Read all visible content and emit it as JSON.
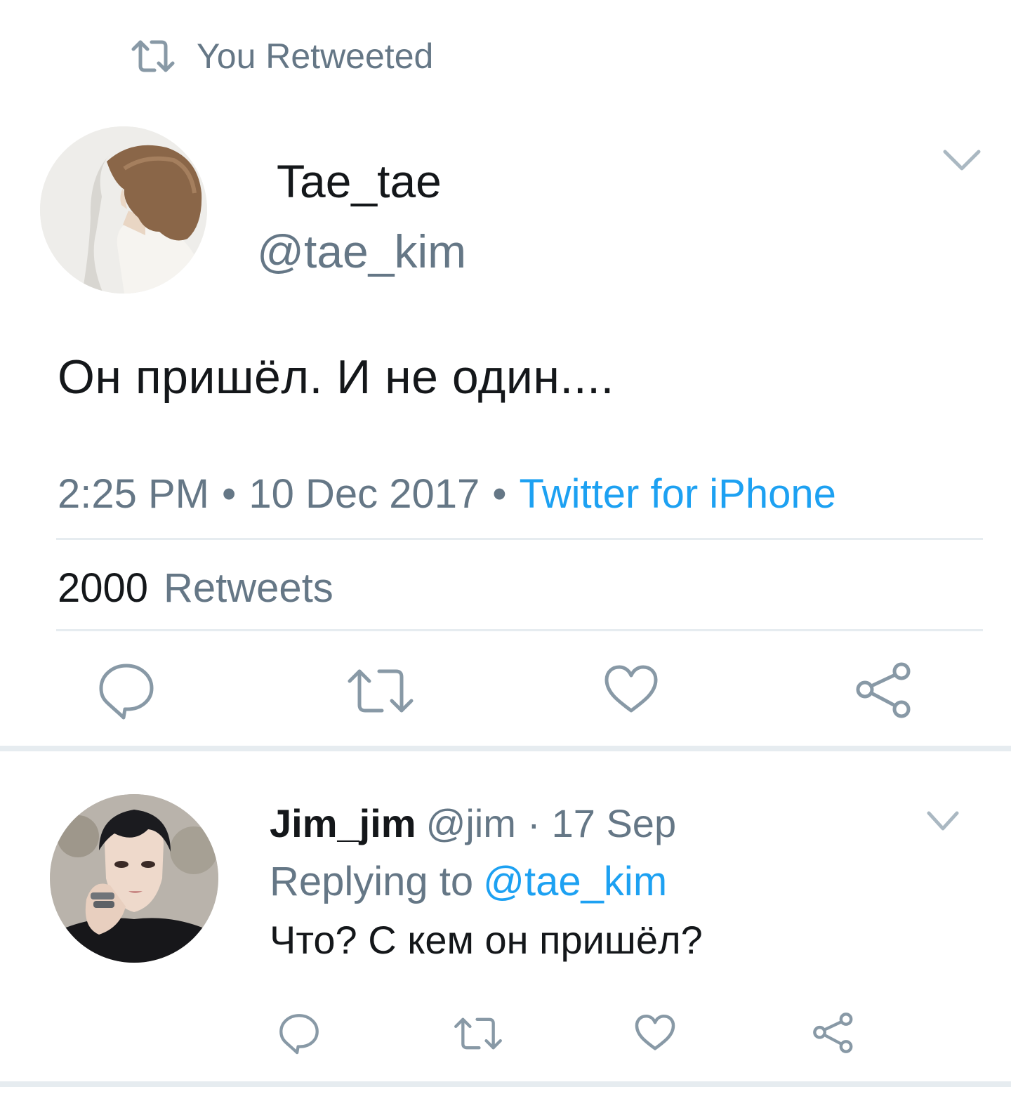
{
  "retweet_context": {
    "text": "You Retweeted",
    "icon": "retweet-icon"
  },
  "main_tweet": {
    "display_name": "Tae_tae",
    "handle": "@tae_kim",
    "text": "Он пришёл. И не один....",
    "time": "2:25 PM",
    "date": "10 Dec 2017",
    "separator": "•",
    "source": "Twitter for iPhone",
    "retweet_count": "2000",
    "retweet_label": "Retweets",
    "actions": [
      "reply-icon",
      "retweet-icon",
      "like-icon",
      "share-icon"
    ]
  },
  "reply_tweet": {
    "display_name": "Jim_jim",
    "handle": "@jim",
    "separator": "·",
    "date": "17 Sep",
    "replying_label": "Replying to",
    "replying_to": "@tae_kim",
    "text": "Что? С кем он пришёл?",
    "actions": [
      "reply-icon",
      "retweet-icon",
      "like-icon",
      "share-icon"
    ]
  },
  "colors": {
    "text_primary": "#14171a",
    "text_secondary": "#657786",
    "accent": "#1da1f2",
    "icon_gray": "#8899a6",
    "divider": "#e6ecf0"
  }
}
